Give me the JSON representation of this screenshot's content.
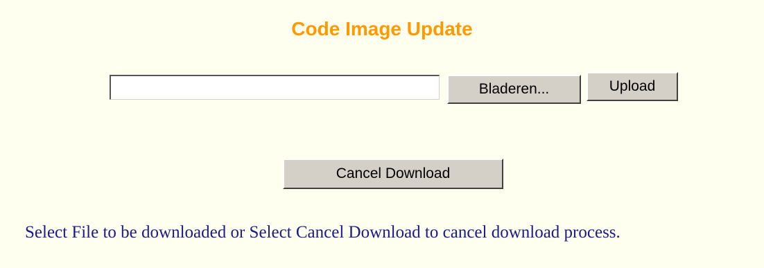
{
  "page": {
    "title": "Code Image Update",
    "instructions": "Select File to be downloaded or Select Cancel Download to cancel download process."
  },
  "upload_form": {
    "file_value": "",
    "browse_label": "Bladeren...",
    "upload_label": "Upload"
  },
  "cancel": {
    "label": "Cancel Download"
  },
  "colors": {
    "background": "#fffff0",
    "title": "#ff9900",
    "instructions_text": "#1a1a8c",
    "button_face": "#d4d0c8"
  }
}
